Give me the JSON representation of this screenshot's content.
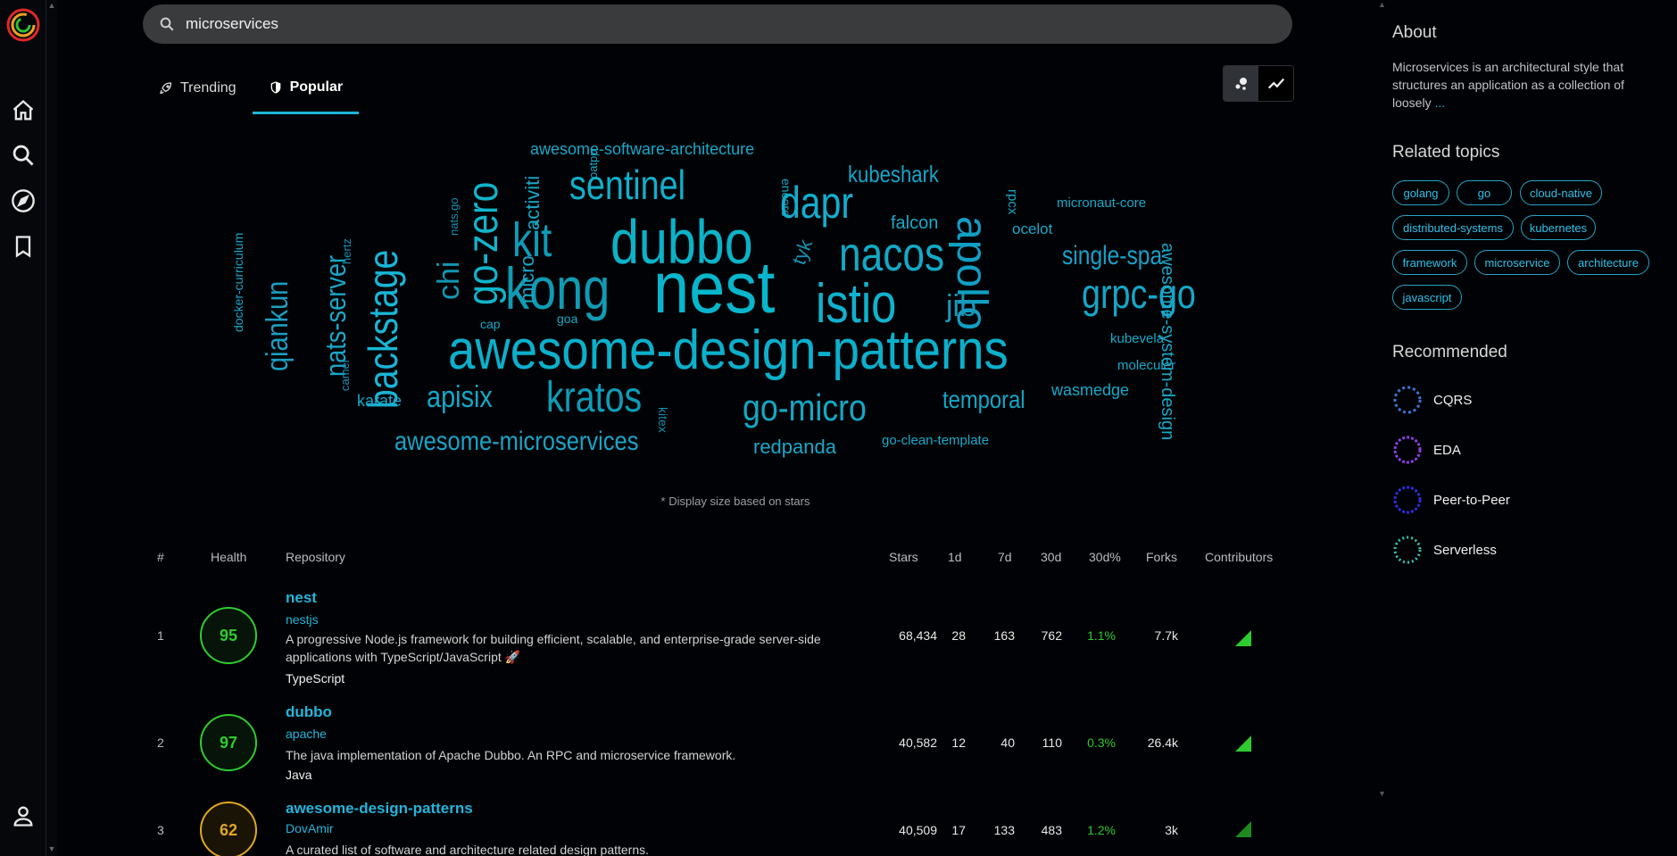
{
  "search": {
    "value": "microservices"
  },
  "tabs": [
    {
      "label": "Trending"
    },
    {
      "label": "Popular"
    }
  ],
  "cloud": {
    "words": [
      {
        "t": "awesome-software-architecture"
      },
      {
        "t": "sentinel"
      },
      {
        "t": "kubeshark"
      },
      {
        "t": "dubbo"
      },
      {
        "t": "dapr"
      },
      {
        "t": "go-zero"
      },
      {
        "t": "kit"
      },
      {
        "t": "nacos"
      },
      {
        "t": "kong"
      },
      {
        "t": "nest"
      },
      {
        "t": "istio"
      },
      {
        "t": "apollo"
      },
      {
        "t": "grpc-go"
      },
      {
        "t": "single-spa"
      },
      {
        "t": "awesome-design-patterns"
      },
      {
        "t": "backstage"
      },
      {
        "t": "nats-server"
      },
      {
        "t": "qiankun"
      },
      {
        "t": "chi"
      },
      {
        "t": "micro"
      },
      {
        "t": "activiti"
      },
      {
        "t": "encore"
      },
      {
        "t": "falcon"
      },
      {
        "t": "rpcx"
      },
      {
        "t": "micronaut-core"
      },
      {
        "t": "ocelot"
      },
      {
        "t": "tyk"
      },
      {
        "t": "jib"
      },
      {
        "t": "kubevela"
      },
      {
        "t": "moleculer"
      },
      {
        "t": "wasmedge"
      },
      {
        "t": "temporal"
      },
      {
        "t": "go-micro"
      },
      {
        "t": "kratos"
      },
      {
        "t": "apisix"
      },
      {
        "t": "karate"
      },
      {
        "t": "awesome-microservices"
      },
      {
        "t": "redpanda"
      },
      {
        "t": "go-clean-template"
      },
      {
        "t": "kitex"
      },
      {
        "t": "cap"
      },
      {
        "t": "goa"
      },
      {
        "t": "nats.go"
      },
      {
        "t": "oatpp"
      },
      {
        "t": "hertz"
      },
      {
        "t": "camel"
      },
      {
        "t": "docker-curriculum"
      },
      {
        "t": "awesome-system-design"
      }
    ],
    "note": "* Display size based on stars"
  },
  "table": {
    "headers": {
      "rank": "#",
      "health": "Health",
      "repo": "Repository",
      "stars": "Stars",
      "d1": "1d",
      "d7": "7d",
      "d30": "30d",
      "pct": "30d%",
      "forks": "Forks",
      "contributors": "Contributors"
    },
    "rows": [
      {
        "rank": "1",
        "health": "95",
        "name": "nest",
        "owner": "nestjs",
        "desc": "A progressive Node.js framework for building efficient, scalable, and enterprise-grade server-side applications with TypeScript/JavaScript 🚀",
        "lang": "TypeScript",
        "stars": "68,434",
        "d1": "28",
        "d7": "163",
        "d30": "762",
        "pct": "1.1%",
        "forks": "7.7k"
      },
      {
        "rank": "2",
        "health": "97",
        "name": "dubbo",
        "owner": "apache",
        "desc": "The java implementation of Apache Dubbo. An RPC and microservice framework.",
        "lang": "Java",
        "stars": "40,582",
        "d1": "12",
        "d7": "40",
        "d30": "110",
        "pct": "0.3%",
        "forks": "26.4k"
      },
      {
        "rank": "3",
        "health": "62",
        "name": "awesome-design-patterns",
        "owner": "DovAmir",
        "desc": "A curated list of software and architecture related design patterns.",
        "lang": "",
        "stars": "40,509",
        "d1": "17",
        "d7": "133",
        "d30": "483",
        "pct": "1.2%",
        "forks": "3k"
      }
    ]
  },
  "about": {
    "title": "About",
    "text": "Microservices is an architectural style that structures an application as a collection of loosely",
    "more": "..."
  },
  "related": {
    "title": "Related topics",
    "topics": [
      "golang",
      "go",
      "cloud-native",
      "distributed-systems",
      "kubernetes",
      "framework",
      "microservice",
      "architecture",
      "javascript"
    ]
  },
  "recommended": {
    "title": "Recommended",
    "items": [
      {
        "label": "CQRS",
        "color": "#3a78d8"
      },
      {
        "label": "EDA",
        "color": "#8a3fe0"
      },
      {
        "label": "Peer-to-Peer",
        "color": "#2d2ce0"
      },
      {
        "label": "Serverless",
        "color": "#39c6b8"
      }
    ]
  },
  "colors": {
    "accent": "#1cb5d6",
    "healthGood": "#2ecc2e",
    "healthMid": "#e0a820"
  }
}
